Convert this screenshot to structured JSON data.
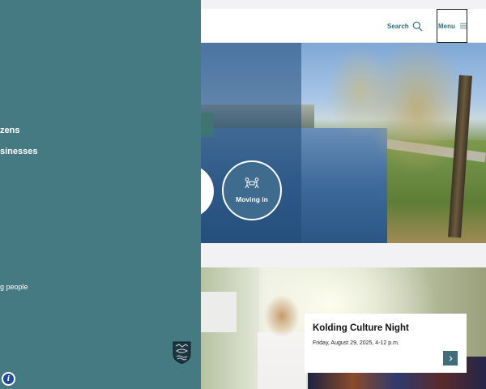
{
  "header": {
    "search_label": "Search",
    "menu_label": "Menu",
    "icons": {
      "search": "search-icon",
      "menu": "hamburger-icon"
    }
  },
  "hero": {
    "quick_links": [
      {
        "label": "Moving in",
        "icon": "people-moving-icon"
      }
    ]
  },
  "event": {
    "title": "Kolding Culture Night",
    "date": "Friday, August 29, 2025, 4-12 p.m."
  },
  "drawer": {
    "items": [
      {
        "label": "zens"
      },
      {
        "label": "sinesses"
      },
      {
        "label": "g people"
      }
    ],
    "logo_icon": "municipal-crest-icon",
    "info_icon": "accessibility-info-icon"
  },
  "colors": {
    "drawer_bg": "#457a82",
    "accent": "#2f6e78",
    "arrow_button": "#3f6e7a"
  }
}
